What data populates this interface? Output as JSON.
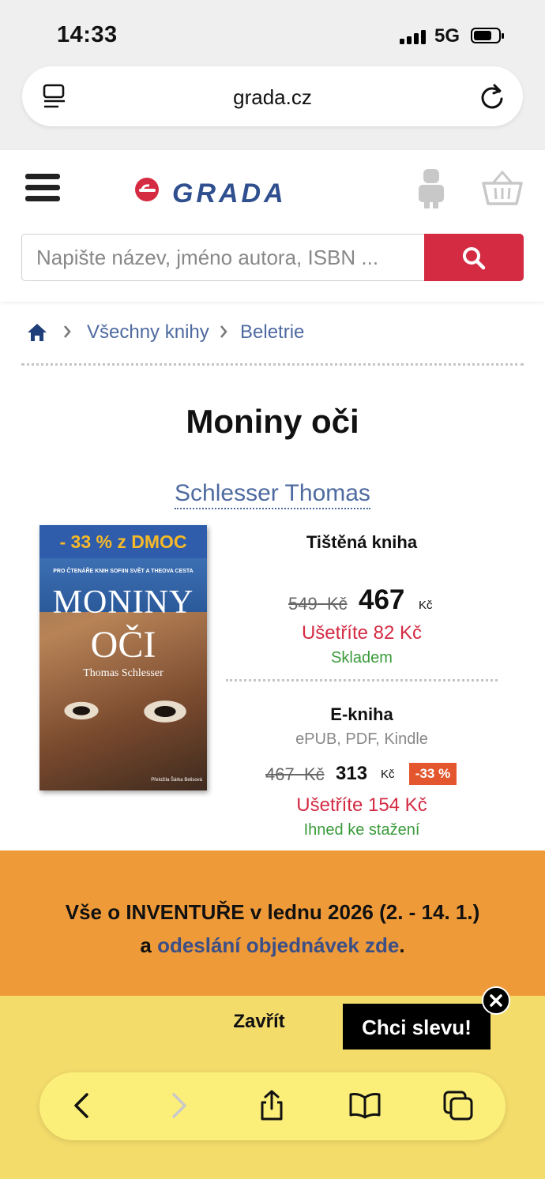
{
  "status_bar": {
    "time": "14:33",
    "network": "5G"
  },
  "browser": {
    "url": "grada.cz"
  },
  "site": {
    "search_placeholder": "Napište název, jméno autora, ISBN ...",
    "breadcrumb": [
      "Všechny knihy",
      "Beletrie"
    ]
  },
  "book": {
    "title": "Moniny oči",
    "author": "Schlesser Thomas",
    "cover": {
      "promo_band": "- 33 % z DMOC",
      "blurb": "PRO ČTENÁŘE KNIH SOFIIN SVĚT A THEOVA CESTA",
      "title_line1": "MONINY",
      "title_line2": "OČI",
      "author": "Thomas Schlesser",
      "translator": "Přeložila Šárka Belisová"
    },
    "print": {
      "label": "Tištěná kniha",
      "old_price": "549",
      "old_currency": "Kč",
      "price": "467",
      "currency": "Kč",
      "savings": "Ušetříte 82 Kč",
      "availability": "Skladem"
    },
    "ebook": {
      "label": "E-kniha",
      "formats": "ePUB, PDF, Kindle",
      "old_price": "467",
      "old_currency": "Kč",
      "price": "313",
      "currency": "Kč",
      "discount": "-33 %",
      "savings": "Ušetříte 154 Kč",
      "availability": "Ihned ke stažení"
    }
  },
  "banner": {
    "line1": "Vše o INVENTUŘE v lednu 2026 (2. - 14. 1.)",
    "line2_prefix": "a ",
    "line2_link": "odeslání objednávek zde",
    "line2_suffix": "."
  },
  "promo_popup": {
    "close_label": "Zavřít",
    "cta_label": "Chci slevu!"
  },
  "colors": {
    "brand_red": "#d42b43",
    "link_blue": "#4e6aa0",
    "banner_orange": "#ef9a39",
    "promo_yellow": "#f4dc6b",
    "stock_green": "#3a9a3a"
  },
  "icons": [
    "reader-icon",
    "reload-icon",
    "menu-icon",
    "user-icon",
    "basket-icon",
    "search-icon",
    "home-icon",
    "chevron-right-icon",
    "close-icon",
    "back-icon",
    "forward-icon",
    "share-icon",
    "bookmarks-icon",
    "tabs-icon"
  ]
}
